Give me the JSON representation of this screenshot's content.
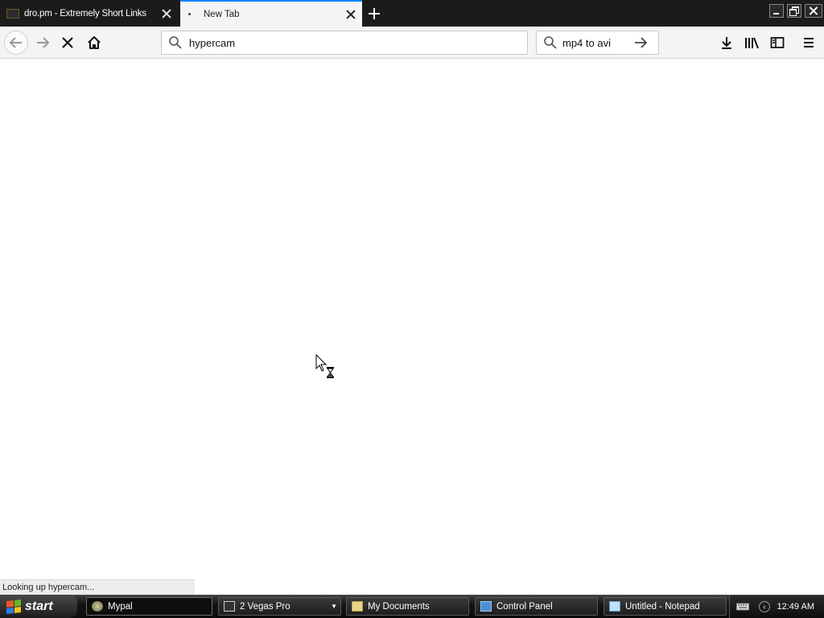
{
  "browser": {
    "tabs": [
      {
        "title": "dro.pm - Extremely Short Links",
        "active": false
      },
      {
        "title": "New Tab",
        "active": true
      }
    ],
    "address_bar": {
      "value": "hypercam"
    },
    "search_bar": {
      "value": "mp4 to avi"
    },
    "status_text": "Looking up hypercam...",
    "accent_color": "#0a84ff"
  },
  "taskbar": {
    "start_label": "start",
    "items": [
      {
        "label": "Mypal",
        "icon": "mypal-icon",
        "active": true
      },
      {
        "label": "2 Vegas Pro",
        "icon": "vegas-icon",
        "active": false
      },
      {
        "label": "My Documents",
        "icon": "folder-icon",
        "active": false
      },
      {
        "label": "Control Panel",
        "icon": "control-panel-icon",
        "active": false
      },
      {
        "label": "Untitled - Notepad",
        "icon": "notepad-icon",
        "active": false
      }
    ],
    "clock": "12:49 AM"
  }
}
